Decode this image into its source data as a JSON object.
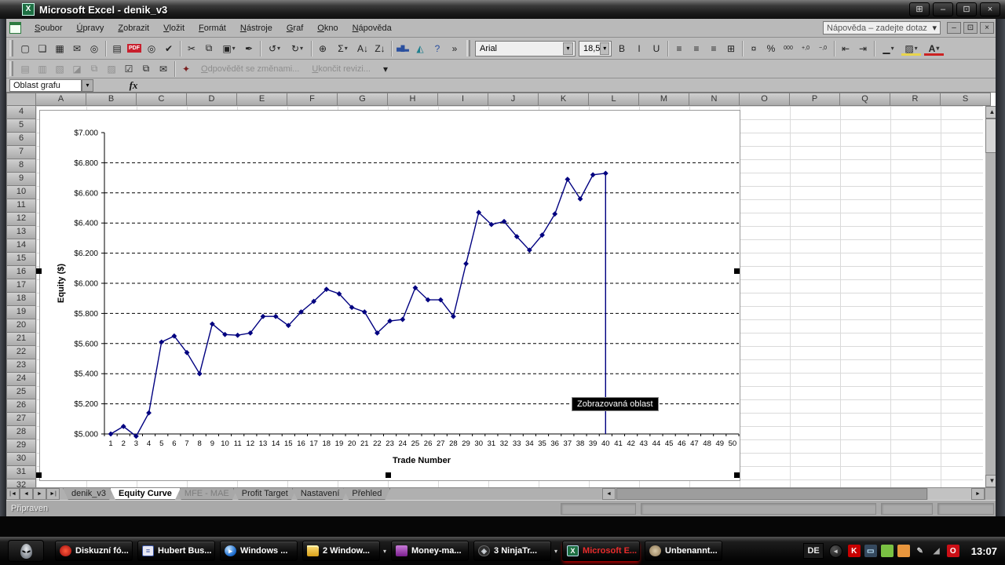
{
  "window": {
    "title": "Microsoft Excel - denik_v3"
  },
  "icons": {
    "flag": "⊞",
    "minimize": "–",
    "restore": "⊡",
    "close": "×",
    "dropdown": "▾",
    "nav_first": "|◄",
    "nav_prev": "◄",
    "nav_next": "►",
    "nav_last": "►|",
    "scroll_up": "▲",
    "scroll_down": "▼",
    "scroll_left": "◄",
    "scroll_right": "►"
  },
  "menu": {
    "items": [
      "Soubor",
      "Úpravy",
      "Zobrazit",
      "Vložit",
      "Formát",
      "Nástroje",
      "Graf",
      "Okno",
      "Nápověda"
    ],
    "help_box": "Nápověda – zadejte dotaz"
  },
  "toolbar_standard": [
    {
      "name": "new-icon",
      "glyph": "▢"
    },
    {
      "name": "open-icon",
      "glyph": "❏"
    },
    {
      "name": "save-icon",
      "glyph": "▦"
    },
    {
      "name": "email-icon",
      "glyph": "✉"
    },
    {
      "name": "search-icon",
      "glyph": "◎"
    },
    {
      "name": "sep"
    },
    {
      "name": "print-icon",
      "glyph": "▤"
    },
    {
      "name": "pdf-icon",
      "glyph": "PDF",
      "badge": true
    },
    {
      "name": "print-preview-icon",
      "glyph": "◎"
    },
    {
      "name": "spelling-icon",
      "glyph": "✔"
    },
    {
      "name": "sep"
    },
    {
      "name": "cut-icon",
      "glyph": "✂"
    },
    {
      "name": "copy-icon",
      "glyph": "⧉"
    },
    {
      "name": "paste-icon",
      "glyph": "▣",
      "dropdown": true
    },
    {
      "name": "format-painter-icon",
      "glyph": "✒"
    },
    {
      "name": "sep"
    },
    {
      "name": "undo-icon",
      "glyph": "↺",
      "dropdown": true
    },
    {
      "name": "redo-icon",
      "glyph": "↻",
      "dropdown": true
    },
    {
      "name": "sep"
    },
    {
      "name": "hyperlink-icon",
      "glyph": "⊕"
    },
    {
      "name": "autosum-icon",
      "glyph": "Σ",
      "dropdown": true
    },
    {
      "name": "sort-asc-icon",
      "glyph": "A↓"
    },
    {
      "name": "sort-desc-icon",
      "glyph": "Z↓"
    },
    {
      "name": "sep"
    },
    {
      "name": "chart-wizard-icon",
      "glyph": "▅█▃",
      "color": "#2a4f9e"
    },
    {
      "name": "drawing-icon",
      "glyph": "◭",
      "color": "#1f7f8e"
    },
    {
      "name": "help-icon",
      "glyph": "?",
      "color": "#2a4f9e"
    },
    {
      "name": "more-buttons-icon",
      "glyph": "»"
    }
  ],
  "toolbar_formatting": {
    "font_name": "Arial",
    "font_size": "18,5",
    "buttons": [
      {
        "name": "bold-button",
        "glyph": "B"
      },
      {
        "name": "italic-button",
        "glyph": "I"
      },
      {
        "name": "underline-button",
        "glyph": "U"
      },
      {
        "name": "sep"
      },
      {
        "name": "align-left-button",
        "glyph": "≡"
      },
      {
        "name": "align-center-button",
        "glyph": "≡"
      },
      {
        "name": "align-right-button",
        "glyph": "≡"
      },
      {
        "name": "merge-center-button",
        "glyph": "⊞"
      },
      {
        "name": "sep"
      },
      {
        "name": "currency-button",
        "glyph": "¤"
      },
      {
        "name": "percent-button",
        "glyph": "%"
      },
      {
        "name": "thousands-button",
        "glyph": "000"
      },
      {
        "name": "increase-decimal-button",
        "glyph": "+,0"
      },
      {
        "name": "decrease-decimal-button",
        "glyph": "−,0"
      },
      {
        "name": "sep"
      },
      {
        "name": "decrease-indent-button",
        "glyph": "⇤"
      },
      {
        "name": "increase-indent-button",
        "glyph": "⇥"
      },
      {
        "name": "sep"
      },
      {
        "name": "borders-button",
        "glyph": "▁",
        "dropdown": true
      },
      {
        "name": "fill-color-button",
        "glyph": "▨",
        "fill": true,
        "dropdown": true
      },
      {
        "name": "font-color-button",
        "glyph": "A",
        "acolor": true,
        "dropdown": true
      }
    ]
  },
  "toolbar_review": {
    "disabled_icons": [
      {
        "name": "picture-icon-1",
        "glyph": "▤"
      },
      {
        "name": "picture-icon-2",
        "glyph": "▥"
      },
      {
        "name": "picture-icon-3",
        "glyph": "▧"
      },
      {
        "name": "picture-icon-4",
        "glyph": "◪"
      },
      {
        "name": "picture-icon-5",
        "glyph": "⧉"
      },
      {
        "name": "picture-icon-6",
        "glyph": "▨"
      }
    ],
    "icons": [
      {
        "name": "checkbox-icon",
        "glyph": "☑"
      },
      {
        "name": "copy-sheet-icon",
        "glyph": "⧉"
      },
      {
        "name": "send-review-icon",
        "glyph": "✉"
      }
    ],
    "reply_label": "Odpovědět se změnami...",
    "end_review_label": "Ukončit revizi...",
    "marker_glyph": "✦"
  },
  "formula_bar": {
    "name_box": "Oblast grafu",
    "fx_label": "fx"
  },
  "sheet": {
    "columns": [
      "A",
      "B",
      "C",
      "D",
      "E",
      "F",
      "G",
      "H",
      "I",
      "J",
      "K",
      "L",
      "M",
      "N",
      "O",
      "P",
      "Q",
      "R",
      "S"
    ],
    "rows": [
      4,
      5,
      6,
      7,
      8,
      9,
      10,
      11,
      12,
      13,
      14,
      15,
      16,
      17,
      18,
      19,
      20,
      21,
      22,
      23,
      24,
      25,
      26,
      27,
      28,
      29,
      30,
      31,
      32
    ]
  },
  "chart_tooltip": "Zobrazovaná oblast",
  "chart_data": {
    "type": "line",
    "title": "",
    "xlabel": "Trade Number",
    "ylabel": "Equity ($)",
    "x": [
      "1",
      "2",
      "3",
      "4",
      "5",
      "6",
      "7",
      "8",
      "9",
      "10",
      "11",
      "12",
      "13",
      "14",
      "15",
      "16",
      "17",
      "18",
      "19",
      "20",
      "21",
      "22",
      "23",
      "24",
      "25",
      "26",
      "27",
      "28",
      "29",
      "30",
      "31",
      "32",
      "33",
      "34",
      "35",
      "36",
      "37",
      "38",
      "39",
      "40",
      "41",
      "42",
      "43",
      "44",
      "45",
      "46",
      "47",
      "48",
      "49",
      "50"
    ],
    "series": [
      {
        "name": "Equity",
        "values": [
          5000,
          5050,
          4985,
          5140,
          5610,
          5650,
          5540,
          5400,
          5730,
          5660,
          5655,
          5670,
          5780,
          5780,
          5720,
          5810,
          5880,
          5960,
          5930,
          5840,
          5810,
          5670,
          5750,
          5760,
          5970,
          5890,
          5890,
          5780,
          6130,
          6470,
          6390,
          6410,
          6310,
          6220,
          6320,
          6460,
          6690,
          6560,
          6720,
          6730
        ]
      }
    ],
    "ylim": [
      5000,
      7000
    ],
    "ytick_step": 200,
    "ytick_labels": [
      "$5.000",
      "$5.200",
      "$5.400",
      "$5.600",
      "$5.800",
      "$6.000",
      "$6.200",
      "$6.400",
      "$6.600",
      "$6.800",
      "$7.000"
    ],
    "grid": "dashed-horizontal",
    "legend": "none",
    "marker": "diamond",
    "color": "#000080",
    "drop_line_at_x": 40
  },
  "tabs": {
    "items": [
      {
        "label": "denik_v3",
        "active": false,
        "muted": false
      },
      {
        "label": "Equity Curve",
        "active": true,
        "muted": false
      },
      {
        "label": "MFE - MAE",
        "active": false,
        "muted": true
      },
      {
        "label": "Profit Target",
        "active": false,
        "muted": false
      },
      {
        "label": "Nastavení",
        "active": false,
        "muted": false
      },
      {
        "label": "Přehled",
        "active": false,
        "muted": false
      }
    ]
  },
  "status": {
    "left": "Připraven"
  },
  "taskbar": {
    "buttons": [
      {
        "label": "Diskuzní fó...",
        "icon": "forum",
        "glyph": "",
        "active": false,
        "dropdown": false
      },
      {
        "label": "Hubert Bus...",
        "icon": "doc",
        "glyph": "≡",
        "active": false,
        "dropdown": false
      },
      {
        "label": "Windows ...",
        "icon": "wmp",
        "glyph": "▸",
        "active": false,
        "dropdown": false
      },
      {
        "label": "2 Window...",
        "icon": "folder",
        "glyph": "",
        "active": false,
        "dropdown": true
      },
      {
        "label": "Money-ma...",
        "icon": "money",
        "glyph": "",
        "active": false,
        "dropdown": false
      },
      {
        "label": "3 NinjaTr...",
        "icon": "ninja",
        "glyph": "◈",
        "active": false,
        "dropdown": true
      },
      {
        "label": "Microsoft E...",
        "icon": "excel",
        "glyph": "X",
        "active": true,
        "dropdown": false
      },
      {
        "label": "Unbenannt...",
        "icon": "gimp",
        "glyph": "",
        "active": false,
        "dropdown": false
      }
    ],
    "language": "DE",
    "collapse_glyph": "◄",
    "tray": [
      {
        "name": "kaspersky-icon",
        "glyph": "K",
        "bg": "#c80000",
        "fg": "#ffffff"
      },
      {
        "name": "display-network-icon",
        "glyph": "▭",
        "bg": "#35495e",
        "fg": "#bfe8ff"
      },
      {
        "name": "messenger-icon",
        "glyph": "",
        "bg": "#7ac143",
        "fg": "#ffffff"
      },
      {
        "name": "contact-icon",
        "glyph": "",
        "bg": "#e8963d",
        "fg": "#2a4f9e"
      },
      {
        "name": "stylus-icon",
        "glyph": "✎",
        "bg": "transparent",
        "fg": "#cccccc"
      },
      {
        "name": "volume-icon",
        "glyph": "◢",
        "bg": "transparent",
        "fg": "#aaaaaa"
      },
      {
        "name": "opera-icon",
        "glyph": "O",
        "bg": "#cc0f16",
        "fg": "#ffffff"
      }
    ],
    "clock": "13:07"
  }
}
